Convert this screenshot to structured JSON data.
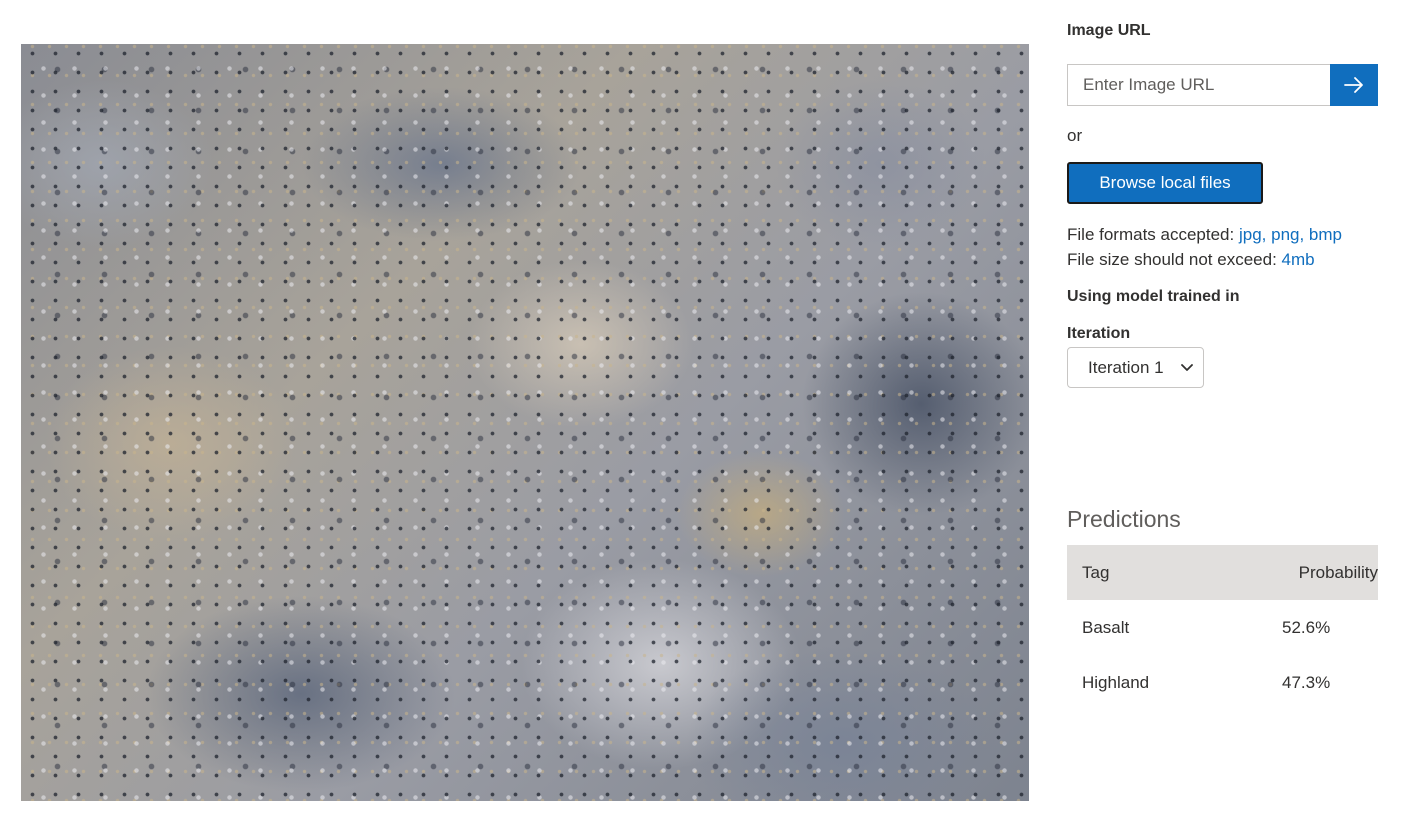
{
  "preview": {
    "subject": "rock surface image"
  },
  "image_url": {
    "label": "Image URL",
    "placeholder": "Enter Image URL",
    "submit_icon": "arrow-right-icon"
  },
  "or_text": "or",
  "browse_label": "Browse local files",
  "file_info": {
    "formats_label": "File formats accepted:",
    "formats_value": "jpg, png, bmp",
    "size_label": "File size should not exceed:",
    "size_value": "4mb"
  },
  "model": {
    "label": "Using model trained in",
    "iteration_label": "Iteration",
    "iteration_selected": "Iteration 1"
  },
  "predictions": {
    "title": "Predictions",
    "columns": [
      "Tag",
      "Probability"
    ],
    "rows": [
      {
        "tag": "Basalt",
        "probability": "52.6%"
      },
      {
        "tag": "Highland",
        "probability": "47.3%"
      }
    ]
  },
  "colors": {
    "accent": "#106ebe",
    "header_bg": "#e1dfdd",
    "text": "#323130"
  }
}
